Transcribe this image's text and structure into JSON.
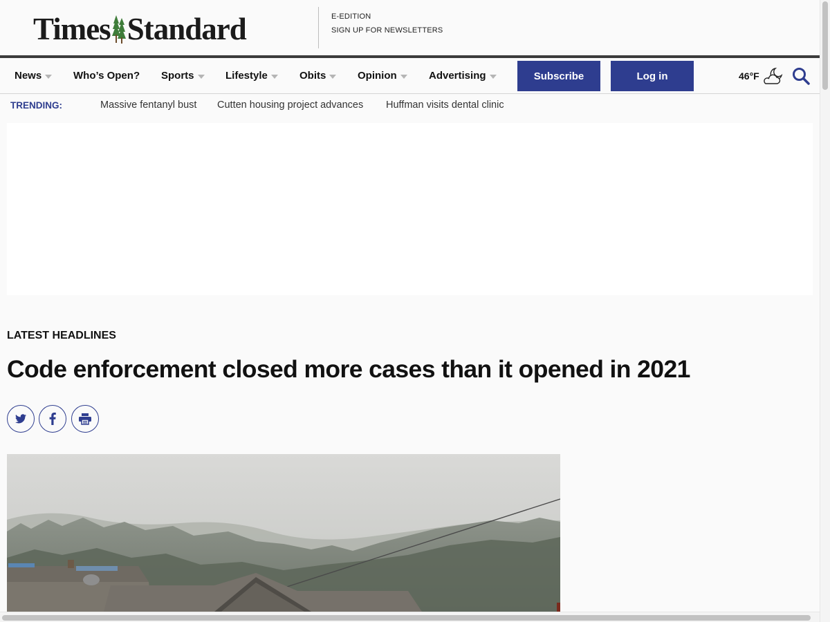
{
  "site": {
    "logo_left": "Times",
    "logo_right": "Standard"
  },
  "top_links": {
    "e_edition": "E-EDITION",
    "newsletters": "SIGN UP FOR NEWSLETTERS"
  },
  "nav": {
    "items": [
      {
        "label": "News",
        "has_dropdown": true
      },
      {
        "label": "Who’s Open?",
        "has_dropdown": false
      },
      {
        "label": "Sports",
        "has_dropdown": true
      },
      {
        "label": "Lifestyle",
        "has_dropdown": true
      },
      {
        "label": "Obits",
        "has_dropdown": true
      },
      {
        "label": "Opinion",
        "has_dropdown": true
      },
      {
        "label": "Advertising",
        "has_dropdown": true
      }
    ],
    "subscribe_label": "Subscribe",
    "login_label": "Log in",
    "temperature": "46°F",
    "weather_icon": "partly-cloudy-night-icon",
    "search_icon": "search-icon"
  },
  "trending": {
    "label": "TRENDING:",
    "links": [
      "Massive fentanyl bust",
      "Cutten housing project advances",
      "Huffman visits dental clinic"
    ]
  },
  "article": {
    "section": "LATEST HEADLINES",
    "headline": "Code enforcement closed more cases than it opened in 2021",
    "share_icons": [
      "twitter-icon",
      "facebook-icon",
      "print-icon"
    ]
  },
  "colors": {
    "brand_blue": "#2e3d8f",
    "page_bg": "#fafafa",
    "rule_dark": "#3b3b3b"
  }
}
